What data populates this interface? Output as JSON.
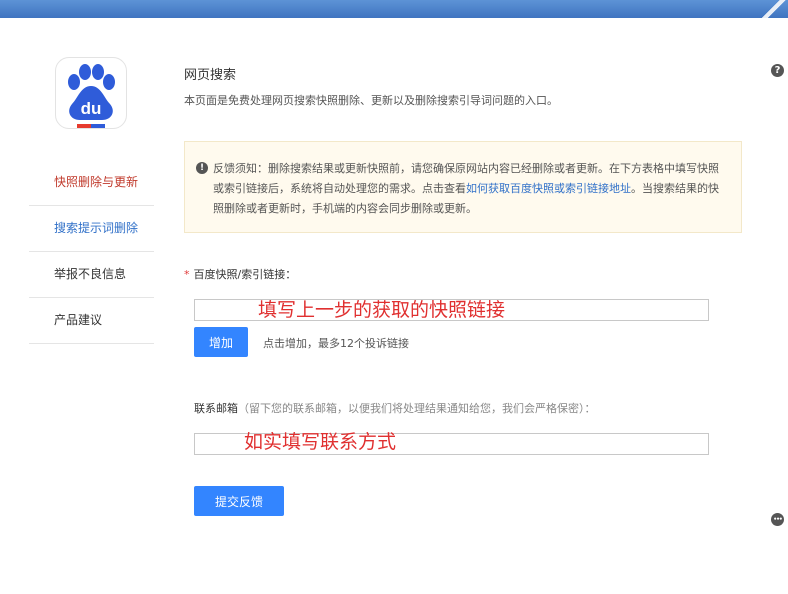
{
  "page": {
    "title": "网页搜索",
    "description": "本页面是免费处理网页搜索快照删除、更新以及删除搜索引导词问题的入口。"
  },
  "logo": {
    "text": "du",
    "brand_color": "#2f5cd9",
    "accent_color": "#e63b2e"
  },
  "nav": {
    "items": [
      {
        "label": "快照删除与更新"
      },
      {
        "label": "搜索提示词删除"
      },
      {
        "label": "举报不良信息"
      },
      {
        "label": "产品建议"
      }
    ]
  },
  "notice": {
    "text_before_link": "反馈须知：删除搜索结果或更新快照前，请您确保原网站内容已经删除或者更新。在下方表格中填写快照或索引链接后，系统将自动处理您的需求。点击查看",
    "link_text": "如何获取百度快照或索引链接地址",
    "text_after_link": "。当搜索结果的快照删除或者更新时，手机端的内容会同步删除或更新。"
  },
  "form": {
    "required_mark": "*",
    "link_label": "百度快照/索引链接：",
    "link_value": "",
    "link_overlay": "填写上一步的获取的快照链接",
    "add_button": "增加",
    "add_hint": "点击增加，最多12个投诉链接",
    "email_label": "联系邮箱",
    "email_hint": "（留下您的联系邮箱，以便我们将处理结果通知给您，我们会严格保密）：",
    "email_value": "",
    "email_overlay": "如实填写联系方式",
    "submit_button": "提交反馈"
  },
  "side_icons": {
    "help": "?",
    "more": "•••"
  },
  "colors": {
    "primary": "#3385ff",
    "active_nav": "#c0392b",
    "link": "#3070c8",
    "overlay_text": "#e03030"
  }
}
